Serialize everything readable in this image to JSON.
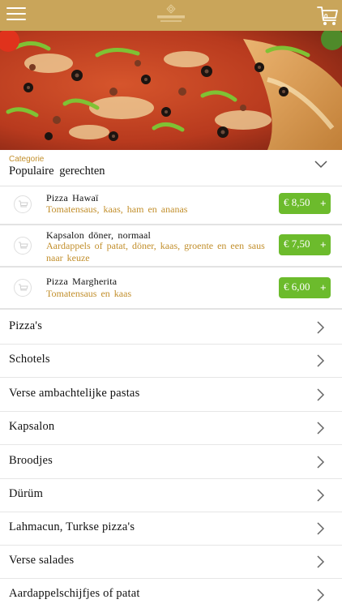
{
  "header": {
    "menu_icon": "hamburger-icon",
    "cart_icon": "cart-icon",
    "cart_count": "0",
    "brand_color": "#c9a55a"
  },
  "category": {
    "small_label": "Categorie",
    "title": "Populaire gerechten",
    "chevron_icon": "chevron-down-icon"
  },
  "dishes": [
    {
      "name": "Pizza Hawaï",
      "description": "Tomatensaus, kaas, ham en ananas",
      "price": "€ 8,50",
      "add": "+"
    },
    {
      "name": "Kapsalon döner, normaal",
      "description": "Aardappels of patat, döner, kaas, groente en een saus naar keuze",
      "price": "€ 7,50",
      "add": "+"
    },
    {
      "name": "Pizza Margherita",
      "description": "Tomatensaus en kaas",
      "price": "€ 6,00",
      "add": "+"
    }
  ],
  "menu": [
    {
      "label": "Pizza's"
    },
    {
      "label": "Schotels"
    },
    {
      "label": "Verse ambachtelijke pastas"
    },
    {
      "label": "Kapsalon"
    },
    {
      "label": "Broodjes"
    },
    {
      "label": "Dürüm"
    },
    {
      "label": "Lahmacun, Turkse pizza's"
    },
    {
      "label": "Verse salades"
    },
    {
      "label": "Aardappelschijfjes of patat"
    }
  ],
  "colors": {
    "accent_gold": "#c28f2c",
    "price_green": "#6cbb2c"
  }
}
